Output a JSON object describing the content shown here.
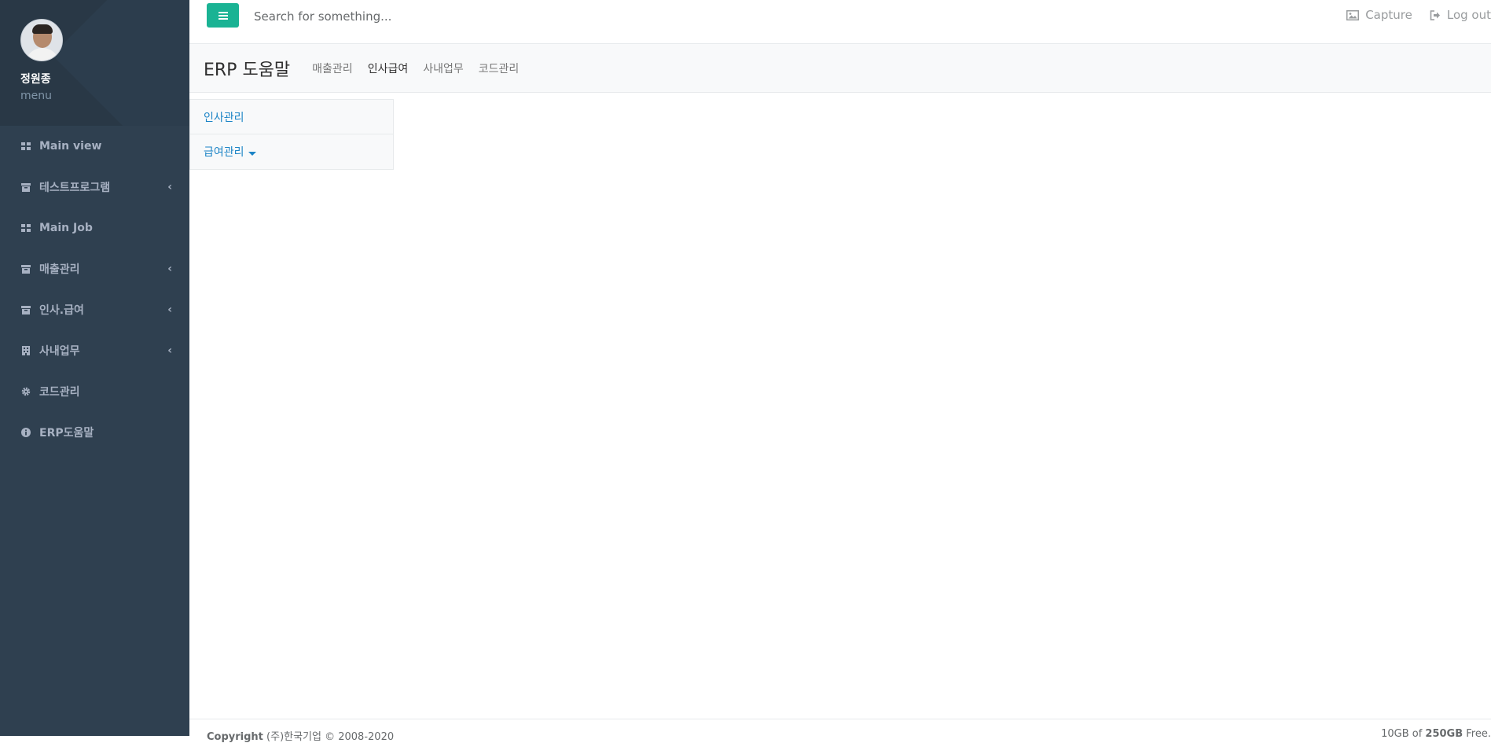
{
  "profile": {
    "name": "정원종",
    "subtitle": "menu"
  },
  "sidebar": {
    "items": [
      {
        "label": "Main view",
        "icon": "grid-icon",
        "has_submenu": false
      },
      {
        "label": "테스트프로그램",
        "icon": "archive-icon",
        "has_submenu": true
      },
      {
        "label": "Main Job",
        "icon": "grid-icon",
        "has_submenu": false
      },
      {
        "label": "매출관리",
        "icon": "archive-icon",
        "has_submenu": true
      },
      {
        "label": "인사.급여",
        "icon": "archive-icon",
        "has_submenu": true
      },
      {
        "label": "사내업무",
        "icon": "building-icon",
        "has_submenu": true
      },
      {
        "label": "코드관리",
        "icon": "gear-icon",
        "has_submenu": false
      },
      {
        "label": "ERP도움말",
        "icon": "info-icon",
        "has_submenu": false
      }
    ],
    "chevron": "‹"
  },
  "topbar": {
    "search_placeholder": "Search for something...",
    "capture_label": "Capture",
    "logout_label": "Log out"
  },
  "heading": {
    "title": "ERP 도움말",
    "tabs": [
      {
        "label": "매출관리",
        "active": false
      },
      {
        "label": "인사급여",
        "active": true
      },
      {
        "label": "사내업무",
        "active": false
      },
      {
        "label": "코드관리",
        "active": false
      }
    ]
  },
  "panel": {
    "items": [
      {
        "label": "인사관리"
      },
      {
        "label": "급여관리"
      }
    ]
  },
  "footer": {
    "copyright_label": "Copyright",
    "copyright_text": " (주)한국기업 © 2008-2020",
    "storage_used": "10GB of ",
    "storage_total": "250GB",
    "storage_suffix": " Free."
  },
  "colors": {
    "sidebar_bg": "#2f4050",
    "accent": "#1ab394",
    "link": "#1c84c6"
  }
}
